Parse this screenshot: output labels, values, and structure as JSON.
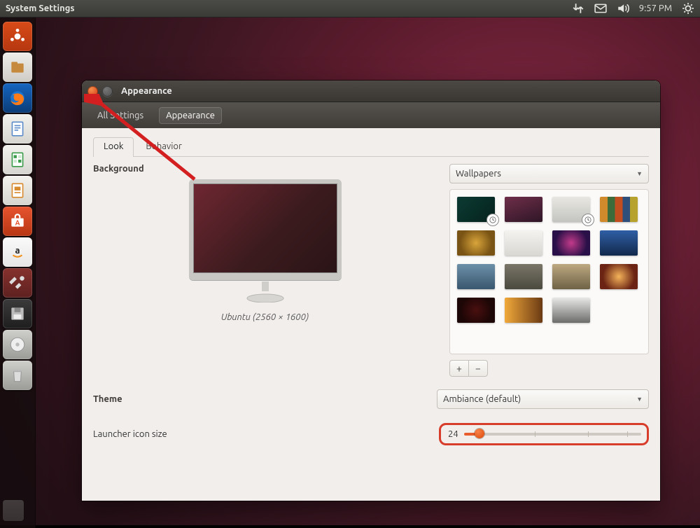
{
  "menubar": {
    "title": "System Settings",
    "time": "9:57 PM"
  },
  "launcher_items": [
    {
      "name": "dash",
      "bg": "linear-gradient(#d84b18,#b63710)"
    },
    {
      "name": "files",
      "bg": "linear-gradient(#efeeea,#cfccc6)"
    },
    {
      "name": "firefox",
      "bg": "linear-gradient(#1565c0,#0b3d78)"
    },
    {
      "name": "writer",
      "bg": "linear-gradient(#f3f2ee,#d7d5cf)"
    },
    {
      "name": "calc",
      "bg": "linear-gradient(#f3f2ee,#d7d5cf)"
    },
    {
      "name": "impress",
      "bg": "linear-gradient(#f3f2ee,#d7d5cf)"
    },
    {
      "name": "software",
      "bg": "linear-gradient(#e6542e,#b83614)"
    },
    {
      "name": "amazon",
      "bg": "linear-gradient(#fafafa,#e6e6e6)"
    },
    {
      "name": "settings",
      "bg": "linear-gradient(#86312e,#5e211f)"
    },
    {
      "name": "floppy",
      "bg": "linear-gradient(#3b3b3b,#1e1e1e)"
    },
    {
      "name": "disc",
      "bg": "linear-gradient(#cfcfcb,#9b9b97)"
    },
    {
      "name": "trash",
      "bg": "linear-gradient(#cfcfcb,#9b9b97)"
    }
  ],
  "window": {
    "title": "Appearance",
    "breadcrumbs": [
      "All Settings",
      "Appearance"
    ],
    "tabs": [
      "Look",
      "Behavior"
    ],
    "active_tab": 0,
    "background_label": "Background",
    "preview_caption": "Ubuntu (2560 × 1600)",
    "wallpapers_combo": "Wallpapers",
    "wallpaper_thumbs": [
      {
        "bg": "linear-gradient(135deg,#0b3b33,#06211d)",
        "checked": true
      },
      {
        "bg": "linear-gradient(160deg,#6f2e4a,#2e1626)",
        "checked": false
      },
      {
        "bg": "linear-gradient(#e9e7e2,#c3c4c0)",
        "checked": true
      },
      {
        "bg": "linear-gradient(90deg,#d08a2b 0 20%,#3d6b3a 20% 40%,#c24e1f 40% 60%,#2d4f7a 60% 80%,#b8a22e 80% 100%)",
        "checked": false
      },
      {
        "bg": "radial-gradient(circle at 50% 50%,#d9a53a,#7a5415 70%)",
        "checked": false
      },
      {
        "bg": "linear-gradient(#f4f3f0,#d9d7d2)",
        "checked": false
      },
      {
        "bg": "radial-gradient(circle at 50% 50%,#c23a8a,#2a1048 70%)",
        "checked": false
      },
      {
        "bg": "linear-gradient(#2f5fa5,#12294c)",
        "checked": false
      },
      {
        "bg": "linear-gradient(#6d90a9,#39576e)",
        "checked": false
      },
      {
        "bg": "linear-gradient(#7a7668,#4b4a3f)",
        "checked": false
      },
      {
        "bg": "linear-gradient(#bda981,#6e6246)",
        "checked": false
      },
      {
        "bg": "radial-gradient(circle at 50% 50%,#f4b35a,#6b2413 70%)",
        "checked": false
      },
      {
        "bg": "radial-gradient(circle at 50% 50%,#4a0f0f,#1c0606 70%)",
        "checked": false
      },
      {
        "bg": "linear-gradient(90deg,#f1a93a,#6b3a14)",
        "checked": false
      },
      {
        "bg": "linear-gradient(#e8e8e6,#6c6c6a)",
        "checked": false
      }
    ],
    "add_label": "+",
    "remove_label": "−",
    "theme_label": "Theme",
    "theme_value": "Ambiance (default)",
    "launcher_size_label": "Launcher icon size",
    "launcher_size_value": "24"
  }
}
